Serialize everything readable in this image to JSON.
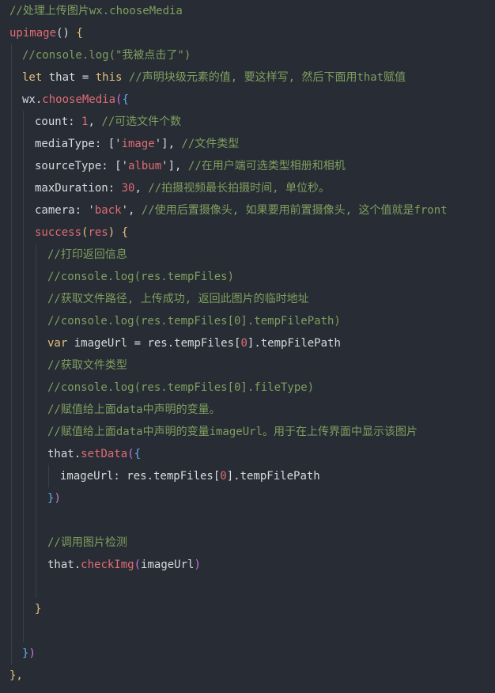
{
  "code": {
    "lines": [
      [
        {
          "t": "//处理上传图片wx.chooseMedia",
          "c": "c-comment"
        }
      ],
      [
        {
          "t": "upimage",
          "c": "c-func"
        },
        {
          "t": "() ",
          "c": "c-punct"
        },
        {
          "t": "{",
          "c": "c-brace-y"
        }
      ],
      [
        {
          "t": "//console.log(\"我被点击了\")",
          "c": "c-comment"
        }
      ],
      [
        {
          "t": "let",
          "c": "c-kw"
        },
        {
          "t": " that = ",
          "c": "c-id"
        },
        {
          "t": "this",
          "c": "c-kw"
        },
        {
          "t": " //声明块级元素的值, 要这样写, 然后下面用that赋值",
          "c": "c-comment"
        }
      ],
      [
        {
          "t": "wx.",
          "c": "c-id"
        },
        {
          "t": "chooseMedia",
          "c": "c-func"
        },
        {
          "t": "(",
          "c": "c-brace-p"
        },
        {
          "t": "{",
          "c": "c-brace-b"
        }
      ],
      [
        {
          "t": "count: ",
          "c": "c-id"
        },
        {
          "t": "1",
          "c": "c-num"
        },
        {
          "t": ", ",
          "c": "c-punct"
        },
        {
          "t": "//可选文件个数",
          "c": "c-comment"
        }
      ],
      [
        {
          "t": "mediaType: ['",
          "c": "c-id"
        },
        {
          "t": "image",
          "c": "c-str"
        },
        {
          "t": "'], ",
          "c": "c-id"
        },
        {
          "t": "//文件类型",
          "c": "c-comment"
        }
      ],
      [
        {
          "t": "sourceType: ['",
          "c": "c-id"
        },
        {
          "t": "album",
          "c": "c-str"
        },
        {
          "t": "'], ",
          "c": "c-id"
        },
        {
          "t": "//在用户端可选类型相册和相机",
          "c": "c-comment"
        }
      ],
      [
        {
          "t": "maxDuration: ",
          "c": "c-id"
        },
        {
          "t": "30",
          "c": "c-num"
        },
        {
          "t": ", ",
          "c": "c-punct"
        },
        {
          "t": "//拍摄视频最长拍摄时间, 单位秒。",
          "c": "c-comment"
        }
      ],
      [
        {
          "t": "camera: '",
          "c": "c-id"
        },
        {
          "t": "back",
          "c": "c-str"
        },
        {
          "t": "', ",
          "c": "c-id"
        },
        {
          "t": "//使用后置摄像头, 如果要用前置摄像头, 这个值就是front",
          "c": "c-comment"
        }
      ],
      [
        {
          "t": "success",
          "c": "c-func"
        },
        {
          "t": "(",
          "c": "c-brace-y"
        },
        {
          "t": "res",
          "c": "c-func"
        },
        {
          "t": ") ",
          "c": "c-brace-y"
        },
        {
          "t": "{",
          "c": "c-brace-y"
        }
      ],
      [
        {
          "t": "//打印返回信息",
          "c": "c-comment"
        }
      ],
      [
        {
          "t": "//console.log(res.tempFiles)",
          "c": "c-comment"
        }
      ],
      [
        {
          "t": "//获取文件路径, 上传成功, 返回此图片的临时地址",
          "c": "c-comment"
        }
      ],
      [
        {
          "t": "//console.log(res.tempFiles[0].tempFilePath)",
          "c": "c-comment"
        }
      ],
      [
        {
          "t": "var",
          "c": "c-kw"
        },
        {
          "t": " imageUrl = res.tempFiles[",
          "c": "c-id"
        },
        {
          "t": "0",
          "c": "c-num"
        },
        {
          "t": "].tempFilePath",
          "c": "c-id"
        }
      ],
      [
        {
          "t": "//获取文件类型",
          "c": "c-comment"
        }
      ],
      [
        {
          "t": "//console.log(res.tempFiles[0].fileType)",
          "c": "c-comment"
        }
      ],
      [
        {
          "t": "//赋值给上面data中声明的变量。",
          "c": "c-comment"
        }
      ],
      [
        {
          "t": "//赋值给上面data中声明的变量imageUrl。用于在上传界面中显示该图片",
          "c": "c-comment"
        }
      ],
      [
        {
          "t": "that.",
          "c": "c-id"
        },
        {
          "t": "setData",
          "c": "c-func"
        },
        {
          "t": "(",
          "c": "c-brace-p"
        },
        {
          "t": "{",
          "c": "c-brace-b"
        }
      ],
      [
        {
          "t": "imageUrl: res.tempFiles[",
          "c": "c-id"
        },
        {
          "t": "0",
          "c": "c-num"
        },
        {
          "t": "].tempFilePath",
          "c": "c-id"
        }
      ],
      [
        {
          "t": "}",
          "c": "c-brace-b"
        },
        {
          "t": ")",
          "c": "c-brace-p"
        }
      ],
      [],
      [
        {
          "t": "//调用图片检测",
          "c": "c-comment"
        }
      ],
      [
        {
          "t": "that.",
          "c": "c-id"
        },
        {
          "t": "checkImg",
          "c": "c-func"
        },
        {
          "t": "(",
          "c": "c-brace-p"
        },
        {
          "t": "imageUrl",
          "c": "c-id"
        },
        {
          "t": ")",
          "c": "c-brace-p"
        }
      ],
      [],
      [],
      [
        {
          "t": "}",
          "c": "c-brace-y"
        }
      ],
      [],
      [],
      [
        {
          "t": "}",
          "c": "c-brace-b"
        },
        {
          "t": ")",
          "c": "c-brace-p"
        }
      ],
      [
        {
          "t": "},",
          "c": "c-brace-y"
        }
      ]
    ]
  }
}
